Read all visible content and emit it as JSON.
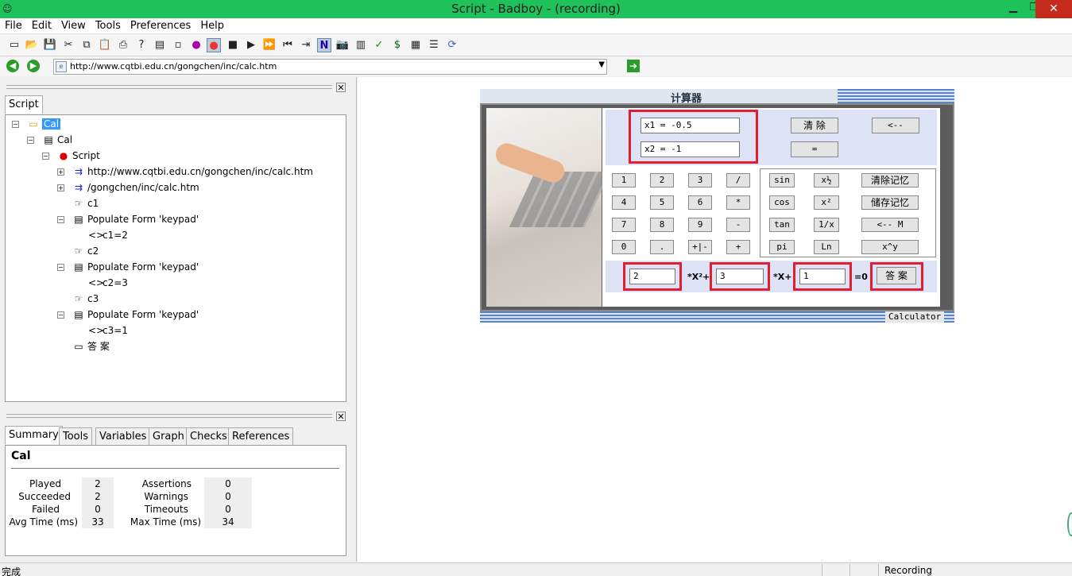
{
  "window": {
    "title": "Script - Badboy - (recording)",
    "minimize": "▁",
    "maximize": "❐",
    "close": "✕"
  },
  "menu": [
    "File",
    "Edit",
    "View",
    "Tools",
    "Preferences",
    "Help"
  ],
  "toolbar_icons": [
    "new-icon",
    "open-icon",
    "save-icon",
    "cut-icon",
    "copy-icon",
    "paste-icon",
    "print-icon",
    "help-icon",
    "new-folder-icon",
    "add-item-icon",
    "add-script-icon",
    "record-icon",
    "stop-icon",
    "play-icon",
    "play-all-icon",
    "rewind-icon",
    "step-icon",
    "n-icon",
    "camera-icon",
    "form-icon",
    "check-icon",
    "dollar-icon",
    "table-icon",
    "tree-icon",
    "refresh-icon"
  ],
  "address": {
    "url": "http://www.cqtbi.edu.cn/gongchen/inc/calc.htm"
  },
  "script_tab": "Script",
  "tree": [
    {
      "label": "Cal",
      "indent": 0
    },
    {
      "label": "Cal",
      "indent": 1
    },
    {
      "label": "Script",
      "indent": 2
    },
    {
      "label": "http://www.cqtbi.edu.cn/gongchen/inc/calc.htm",
      "indent": 3
    },
    {
      "label": "/gongchen/inc/calc.htm",
      "indent": 3
    },
    {
      "label": "c1",
      "indent": 3
    },
    {
      "label": "Populate Form 'keypad'",
      "indent": 3
    },
    {
      "label": "c1=2",
      "indent": 4
    },
    {
      "label": "c2",
      "indent": 3
    },
    {
      "label": "Populate Form 'keypad'",
      "indent": 3
    },
    {
      "label": "c2=3",
      "indent": 4
    },
    {
      "label": "c3",
      "indent": 3
    },
    {
      "label": "Populate Form 'keypad'",
      "indent": 3
    },
    {
      "label": "c3=1",
      "indent": 4
    },
    {
      "label": "答 案",
      "indent": 3
    }
  ],
  "bottom_tabs": [
    "Summary",
    "Tools",
    "Variables",
    "Graph",
    "Checks",
    "References"
  ],
  "summary": {
    "title": "Cal",
    "played_label": "Played",
    "played": "2",
    "succeeded_label": "Succeeded",
    "succeeded": "2",
    "failed_label": "Failed",
    "failed": "0",
    "avg_label": "Avg Time (ms)",
    "avg": "33",
    "assertions_label": "Assertions",
    "assertions": "0",
    "warnings_label": "Warnings",
    "warnings": "0",
    "timeouts_label": "Timeouts",
    "timeouts": "0",
    "max_label": "Max Time (ms)",
    "max": "34"
  },
  "calculator": {
    "title": "计算器",
    "x1": "x1 = -0.5",
    "x2": "x2 = -1",
    "clear": "清 除",
    "back": "<--",
    "equals": "=",
    "keys": [
      "1",
      "2",
      "3",
      "/",
      "4",
      "5",
      "6",
      "*",
      "7",
      "8",
      "9",
      "-",
      "0",
      ".",
      "+|-",
      "+"
    ],
    "sci": [
      "sin",
      "x½",
      "清除记忆",
      "cos",
      "x²",
      "储存记忆",
      "tan",
      "1/x",
      "<-- M",
      "pi",
      "Ln",
      "x^y"
    ],
    "c1": "2",
    "c2": "3",
    "c3": "1",
    "term1": "*X²+",
    "term2": "*X+",
    "term3": "=0",
    "answer": "答 案",
    "footer_tab": "Calculator"
  },
  "status": {
    "left": "完成",
    "right": "Recording"
  }
}
